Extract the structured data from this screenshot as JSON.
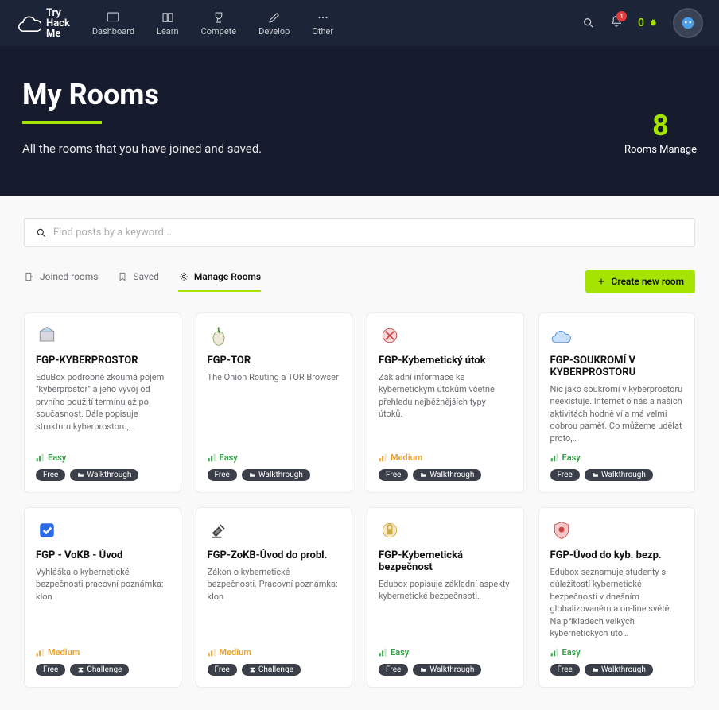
{
  "logo": {
    "line1": "Try",
    "line2": "Hack",
    "line3": "Me"
  },
  "nav": [
    {
      "label": "Dashboard"
    },
    {
      "label": "Learn"
    },
    {
      "label": "Compete"
    },
    {
      "label": "Develop"
    },
    {
      "label": "Other"
    }
  ],
  "notif_count": "1",
  "streak": "0",
  "hero": {
    "title": "My Rooms",
    "subtitle": "All the rooms that you have joined and saved.",
    "count": "8",
    "count_label": "Rooms Manage"
  },
  "search": {
    "placeholder": "Find posts by a keyword..."
  },
  "tabs": [
    {
      "label": "Joined rooms"
    },
    {
      "label": "Saved"
    },
    {
      "label": "Manage Rooms"
    }
  ],
  "create_btn": "Create new room",
  "badge_labels": {
    "free": "Free",
    "walkthrough": "Walkthrough",
    "challenge": "Challenge"
  },
  "difficulty_labels": {
    "easy": "Easy",
    "medium": "Medium"
  },
  "rooms": [
    {
      "title": "FGP-KYBERPROSTOR",
      "desc": "EduBox podrobně zkoumá pojem \"kyberprostor\" a jeho vývoj od prvního použití termínu až po současnost. Dále popisuje strukturu kyberprostoru,…",
      "diff": "easy",
      "badges": [
        "free",
        "walkthrough"
      ],
      "icon": "box"
    },
    {
      "title": "FGP-TOR",
      "desc": "The Onion Routing a TOR Browser",
      "diff": "easy",
      "badges": [
        "free",
        "walkthrough"
      ],
      "icon": "onion"
    },
    {
      "title": "FGP-Kybernetický útok",
      "desc": "Základní informace ke kybernetickým útokům včetně přehledu nejběžnějších typy útoků.",
      "diff": "medium",
      "badges": [
        "free",
        "walkthrough"
      ],
      "icon": "attack"
    },
    {
      "title": "FGP-SOUKROMÍ V KYBERPROSTORU",
      "desc": "Nic jako soukromí v kyberprostoru neexistuje. Internet o nás a našich aktivitách hodně ví a má velmi dobrou paměť. Co můžeme udělat proto,…",
      "diff": "easy",
      "badges": [
        "free",
        "walkthrough"
      ],
      "icon": "cloud"
    },
    {
      "title": "FGP - VoKB - Úvod",
      "desc": "Vyhláška o kybernetické bezpečnosti pracovní poznámka: klon",
      "diff": "medium",
      "badges": [
        "free",
        "challenge"
      ],
      "icon": "check"
    },
    {
      "title": "FGP-ZoKB-Úvod do probl.",
      "desc": "Zákon o kybernetické bezpečnosti. Pracovní poznámka: klon",
      "diff": "medium",
      "badges": [
        "free",
        "challenge"
      ],
      "icon": "gavel"
    },
    {
      "title": "FGP-Kybernetická bezpečnost",
      "desc": "Edubox popisuje základní aspekty kybernetické bezpečnsoti.",
      "diff": "easy",
      "badges": [
        "free",
        "walkthrough"
      ],
      "icon": "secure"
    },
    {
      "title": "FGP-Úvod do kyb. bezp.",
      "desc": "Edubox seznamuje studenty s důležitostí kybernetické bezpečnosti v dnešním globalizovaném a on-line světě. Na příkladech velkých kybernetických úto…",
      "diff": "easy",
      "badges": [
        "free",
        "walkthrough"
      ],
      "icon": "shield"
    }
  ]
}
